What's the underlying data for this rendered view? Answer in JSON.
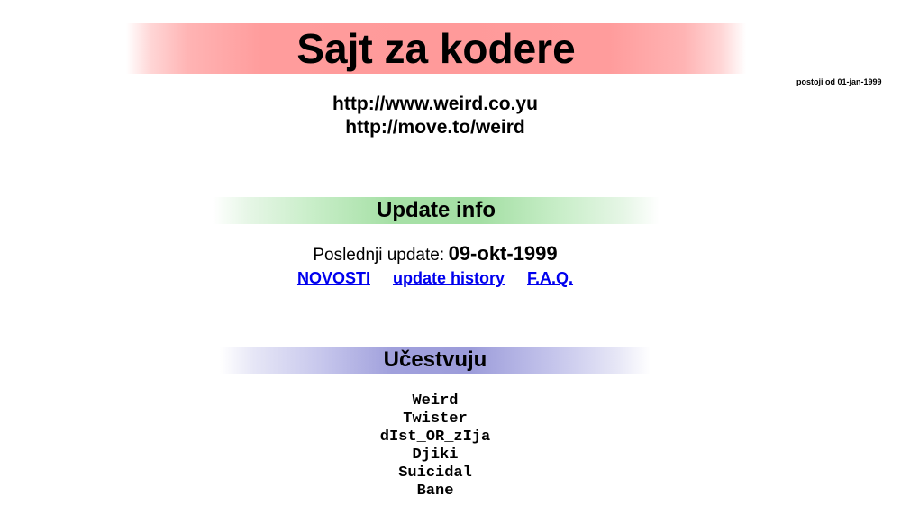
{
  "header": {
    "title": "Sajt za kodere",
    "since": "postoji od 01-jan-1999",
    "urls": [
      "http://www.weird.co.yu",
      "http://move.to/weird"
    ]
  },
  "update_info": {
    "heading": "Update info",
    "last_update_label": "Poslednji update:",
    "last_update_date": "09-okt-1999",
    "links": [
      "NOVOSTI",
      "update history",
      "F.A.Q."
    ]
  },
  "members": {
    "heading": "Učestvuju",
    "names": [
      "Weird",
      "Twister",
      "dIst_OR_zIja",
      "Djiki",
      "Suicidal",
      "Bane"
    ]
  },
  "colors": {
    "title_bar": "#ff9a9a",
    "update_bar": "#a4dfa4",
    "members_bar": "#9c9cda",
    "link": "#0000ee"
  }
}
